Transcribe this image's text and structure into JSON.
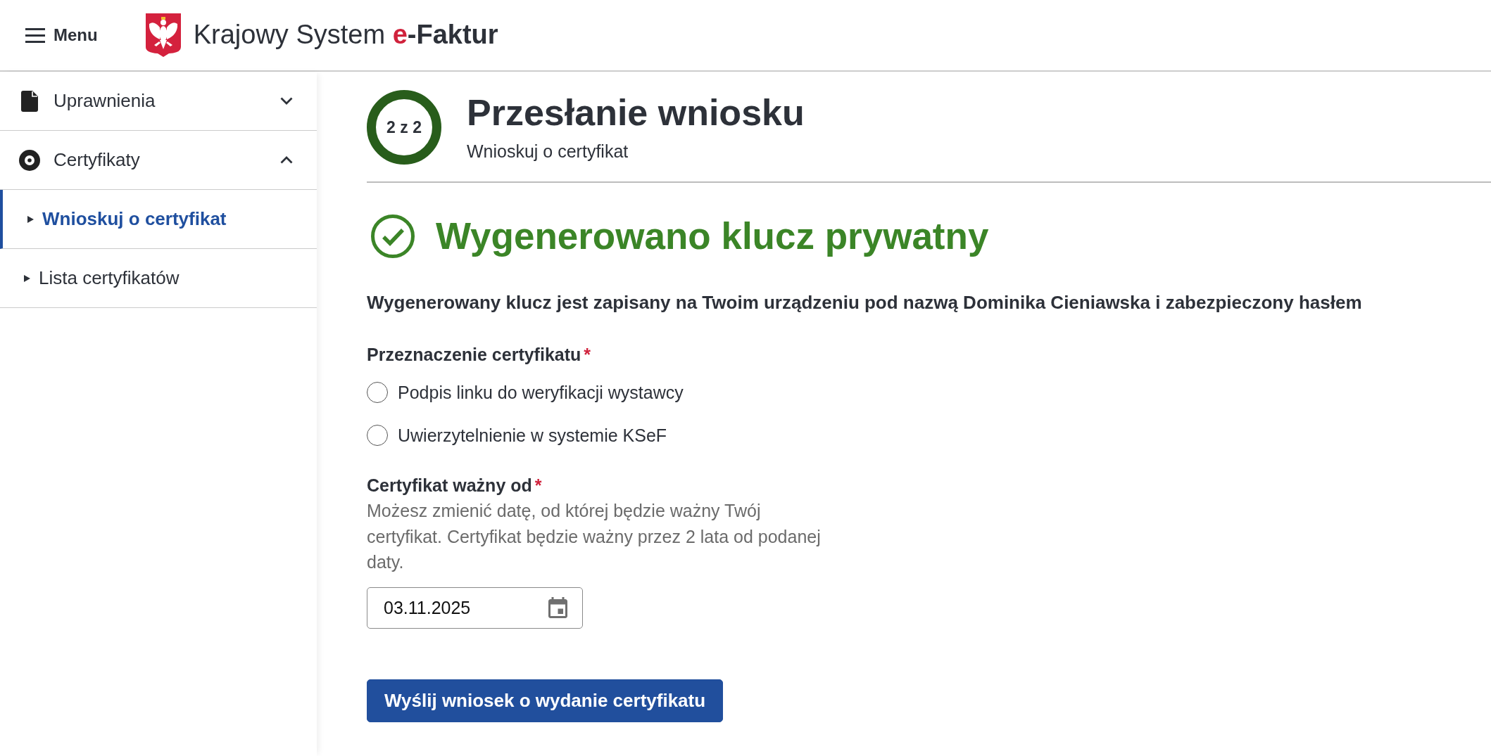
{
  "header": {
    "menu_label": "Menu",
    "title": "Krajowy System",
    "title_accent": "e",
    "title_suffix": "-Faktur"
  },
  "sidebar": {
    "items": [
      {
        "label": "Uprawnienia",
        "expanded": false
      },
      {
        "label": "Certyfikaty",
        "expanded": true,
        "children": [
          {
            "label": "Wnioskuj o certyfikat",
            "selected": true
          },
          {
            "label": "Lista certyfikatów",
            "selected": false
          }
        ]
      }
    ]
  },
  "step": {
    "counter": "2 z 2",
    "title": "Przesłanie wniosku",
    "subtitle": "Wnioskuj o certyfikat"
  },
  "status": {
    "kind": "success",
    "title": "Wygenerowano klucz prywatny",
    "message": "Wygenerowany klucz jest zapisany na Twoim urządzeniu pod nazwą Dominika Cieniawska i zabezpieczony hasłem"
  },
  "form": {
    "purpose": {
      "label": "Przeznaczenie certyfikatu",
      "required_mark": "*",
      "options": [
        {
          "label": "Podpis linku do weryfikacji wystawcy",
          "selected": false
        },
        {
          "label": "Uwierzytelnienie w systemie KSeF",
          "selected": false
        }
      ]
    },
    "valid_from": {
      "label": "Certyfikat ważny od",
      "required_mark": "*",
      "hint": "Możesz zmienić datę, od której będzie ważny Twój certyfikat. Certyfikat będzie ważny przez 2 lata od podanej daty.",
      "value": "03.11.2025"
    },
    "submit": {
      "label": "Wyślij wniosek o wydanie certyfikatu"
    }
  }
}
